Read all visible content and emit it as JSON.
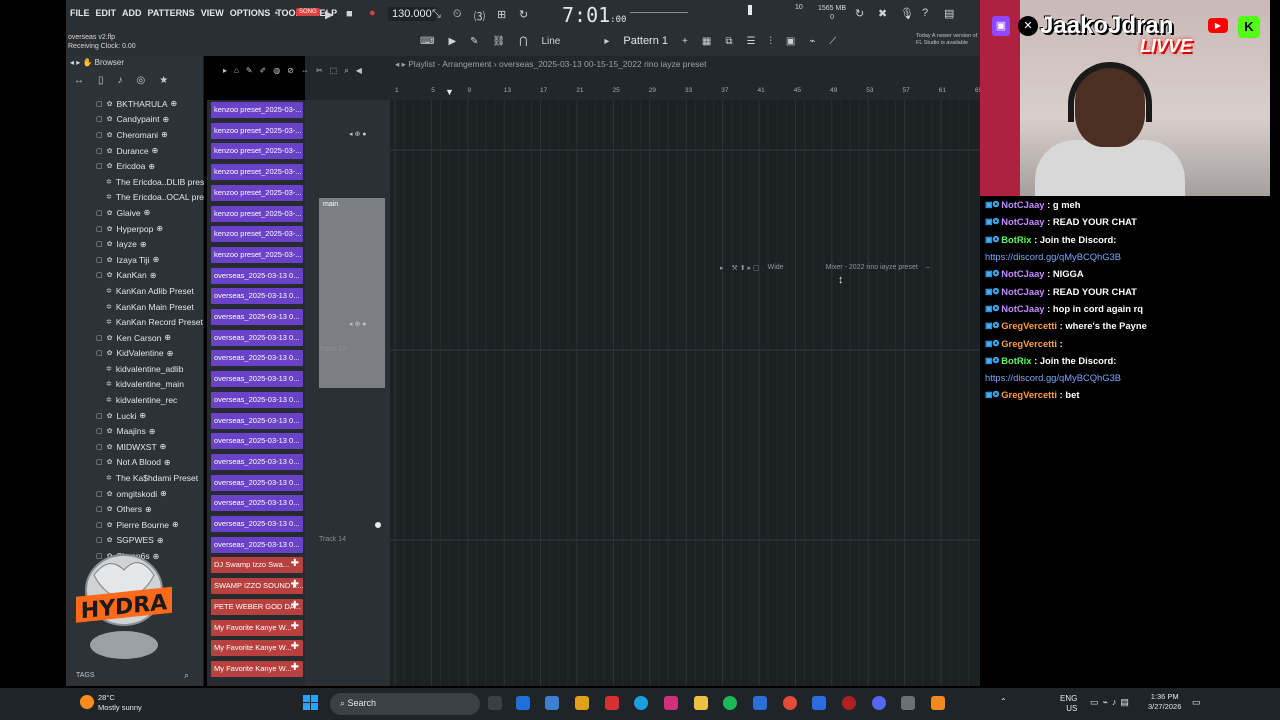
{
  "app": {
    "menu": [
      "FILE",
      "EDIT",
      "ADD",
      "PATTERNS",
      "VIEW",
      "OPTIONS",
      "TOOLS",
      "HELP"
    ],
    "project_file": "overseas v2.flp",
    "receiving_clock": "Receiving Clock: 0.00",
    "tempo": "130.000",
    "time_main": "7:01",
    "time_sub": ":00",
    "memory": "1565 MB",
    "memory_sub": "0",
    "cpu_count": "10",
    "snap_mode": "Line",
    "pattern": "Pattern 1",
    "news": "Today  A newer version of FL Studio is available"
  },
  "browser": {
    "title": "Browser",
    "tags_label": "TAGS",
    "items": [
      {
        "label": "BKTHARULA",
        "type": "folder"
      },
      {
        "label": "Candypaint",
        "type": "folder"
      },
      {
        "label": "Cheromani",
        "type": "folder"
      },
      {
        "label": "Durance",
        "type": "folder"
      },
      {
        "label": "Ericdoa",
        "type": "folder"
      },
      {
        "label": "The Ericdoa..DLIB preset",
        "type": "file"
      },
      {
        "label": "The Ericdoa..OCAL preset",
        "type": "file"
      },
      {
        "label": "Glaive",
        "type": "folder"
      },
      {
        "label": "Hyperpop",
        "type": "folder"
      },
      {
        "label": "Iayze",
        "type": "folder"
      },
      {
        "label": "Izaya Tiji",
        "type": "folder"
      },
      {
        "label": "KanKan",
        "type": "folder"
      },
      {
        "label": "KanKan Adlib Preset",
        "type": "file"
      },
      {
        "label": "KanKan Main Preset",
        "type": "file"
      },
      {
        "label": "KanKan Record Preset",
        "type": "file"
      },
      {
        "label": "Ken Carson",
        "type": "folder"
      },
      {
        "label": "KidValentine",
        "type": "folder"
      },
      {
        "label": "kidvalentine_adlib",
        "type": "file"
      },
      {
        "label": "kidvalentine_main",
        "type": "file"
      },
      {
        "label": "kidvalentine_rec",
        "type": "file"
      },
      {
        "label": "Lucki",
        "type": "folder"
      },
      {
        "label": "Maajins",
        "type": "folder"
      },
      {
        "label": "MIDWXST",
        "type": "folder"
      },
      {
        "label": "Not A Blood",
        "type": "folder"
      },
      {
        "label": "The Ka$hdami Preset",
        "type": "file"
      },
      {
        "label": "omgitskodi",
        "type": "folder"
      },
      {
        "label": "Others",
        "type": "folder"
      },
      {
        "label": "Pierre Bourne",
        "type": "folder"
      },
      {
        "label": "SGPWES",
        "type": "folder"
      },
      {
        "label": "Slump6s",
        "type": "folder"
      }
    ]
  },
  "patterns": {
    "purple": [
      "kenzoo preset_2025-03-...",
      "kenzoo preset_2025-03-...",
      "kenzoo preset_2025-03-...",
      "kenzoo preset_2025-03-...",
      "kenzoo preset_2025-03-...",
      "kenzoo preset_2025-03-...",
      "kenzoo preset_2025-03-...",
      "kenzoo preset_2025-03-...",
      "overseas_2025-03-13 0...",
      "overseas_2025-03-13 0...",
      "overseas_2025-03-13 0...",
      "overseas_2025-03-13 0...",
      "overseas_2025-03-13 0...",
      "overseas_2025-03-13 0...",
      "overseas_2025-03-13 0...",
      "overseas_2025-03-13 0...",
      "overseas_2025-03-13 0...",
      "overseas_2025-03-13 0...",
      "overseas_2025-03-13 0...",
      "overseas_2025-03-13 0...",
      "overseas_2025-03-13 0...",
      "overseas_2025-03-13 0..."
    ],
    "red": [
      "DJ Swamp Izzo Swa...",
      "SWAMP IZZO SOUND E...",
      "PETE WEBER GOD DA...",
      "My Favorite Kanye W...",
      "My Favorite Kanye W...",
      "My Favorite Kanye W..."
    ]
  },
  "playlist": {
    "title": "Playlist - Arrangement",
    "arrangement": "overseas_2025-03-13 00-15-15_2022 rino iayze preset",
    "ruler": [
      "1",
      "5",
      "9",
      "13",
      "17",
      "21",
      "25",
      "29",
      "33",
      "37",
      "41",
      "45",
      "49",
      "53",
      "57",
      "61",
      "65"
    ],
    "main_clip": "main",
    "track13": "Track 13",
    "track14": "Track 14",
    "mixer_wide": "Wide",
    "mixer_title": "Mixer - 2022 rino iayze preset"
  },
  "stream": {
    "name": "JaakoJdran",
    "live": "LIVVE",
    "chat": [
      {
        "user": "NotCJaay",
        "color": "u1",
        "msg": "g meh"
      },
      {
        "user": "NotCJaay",
        "color": "u1",
        "msg": "READ YOUR CHAT"
      },
      {
        "user": "BotRix",
        "color": "u2",
        "msg": "Join the Discord:"
      },
      {
        "user": "",
        "color": "",
        "msg": "https://discord.gg/qMyBCQhG3B",
        "link": true
      },
      {
        "user": "NotCJaay",
        "color": "u1",
        "msg": "NIGGA"
      },
      {
        "user": "NotCJaay",
        "color": "u1",
        "msg": "READ YOUR CHAT"
      },
      {
        "user": "NotCJaay",
        "color": "u1",
        "msg": "hop in cord again rq"
      },
      {
        "user": "GregVercetti",
        "color": "u3",
        "msg": "where's the Payne"
      },
      {
        "user": "GregVercetti",
        "color": "u3",
        "msg": ""
      },
      {
        "user": "BotRix",
        "color": "u2",
        "msg": "Join the Discord:"
      },
      {
        "user": "",
        "color": "",
        "msg": "https://discord.gg/qMyBCQhG3B",
        "link": true
      },
      {
        "user": "GregVercetti",
        "color": "u3",
        "msg": "bet"
      }
    ]
  },
  "taskbar": {
    "temp": "28°C",
    "weather": "Mostly sunny",
    "search": "Search",
    "lang": "ENG",
    "region": "US",
    "time": "1:36 PM",
    "date": "3/27/2026"
  },
  "colors": {
    "pattern_purple": "#6a42c9",
    "pattern_red": "#b8403f",
    "chat_user_purple": "#c58cff",
    "chat_user_green": "#53ff53",
    "chat_user_orange": "#ff9f3e"
  }
}
